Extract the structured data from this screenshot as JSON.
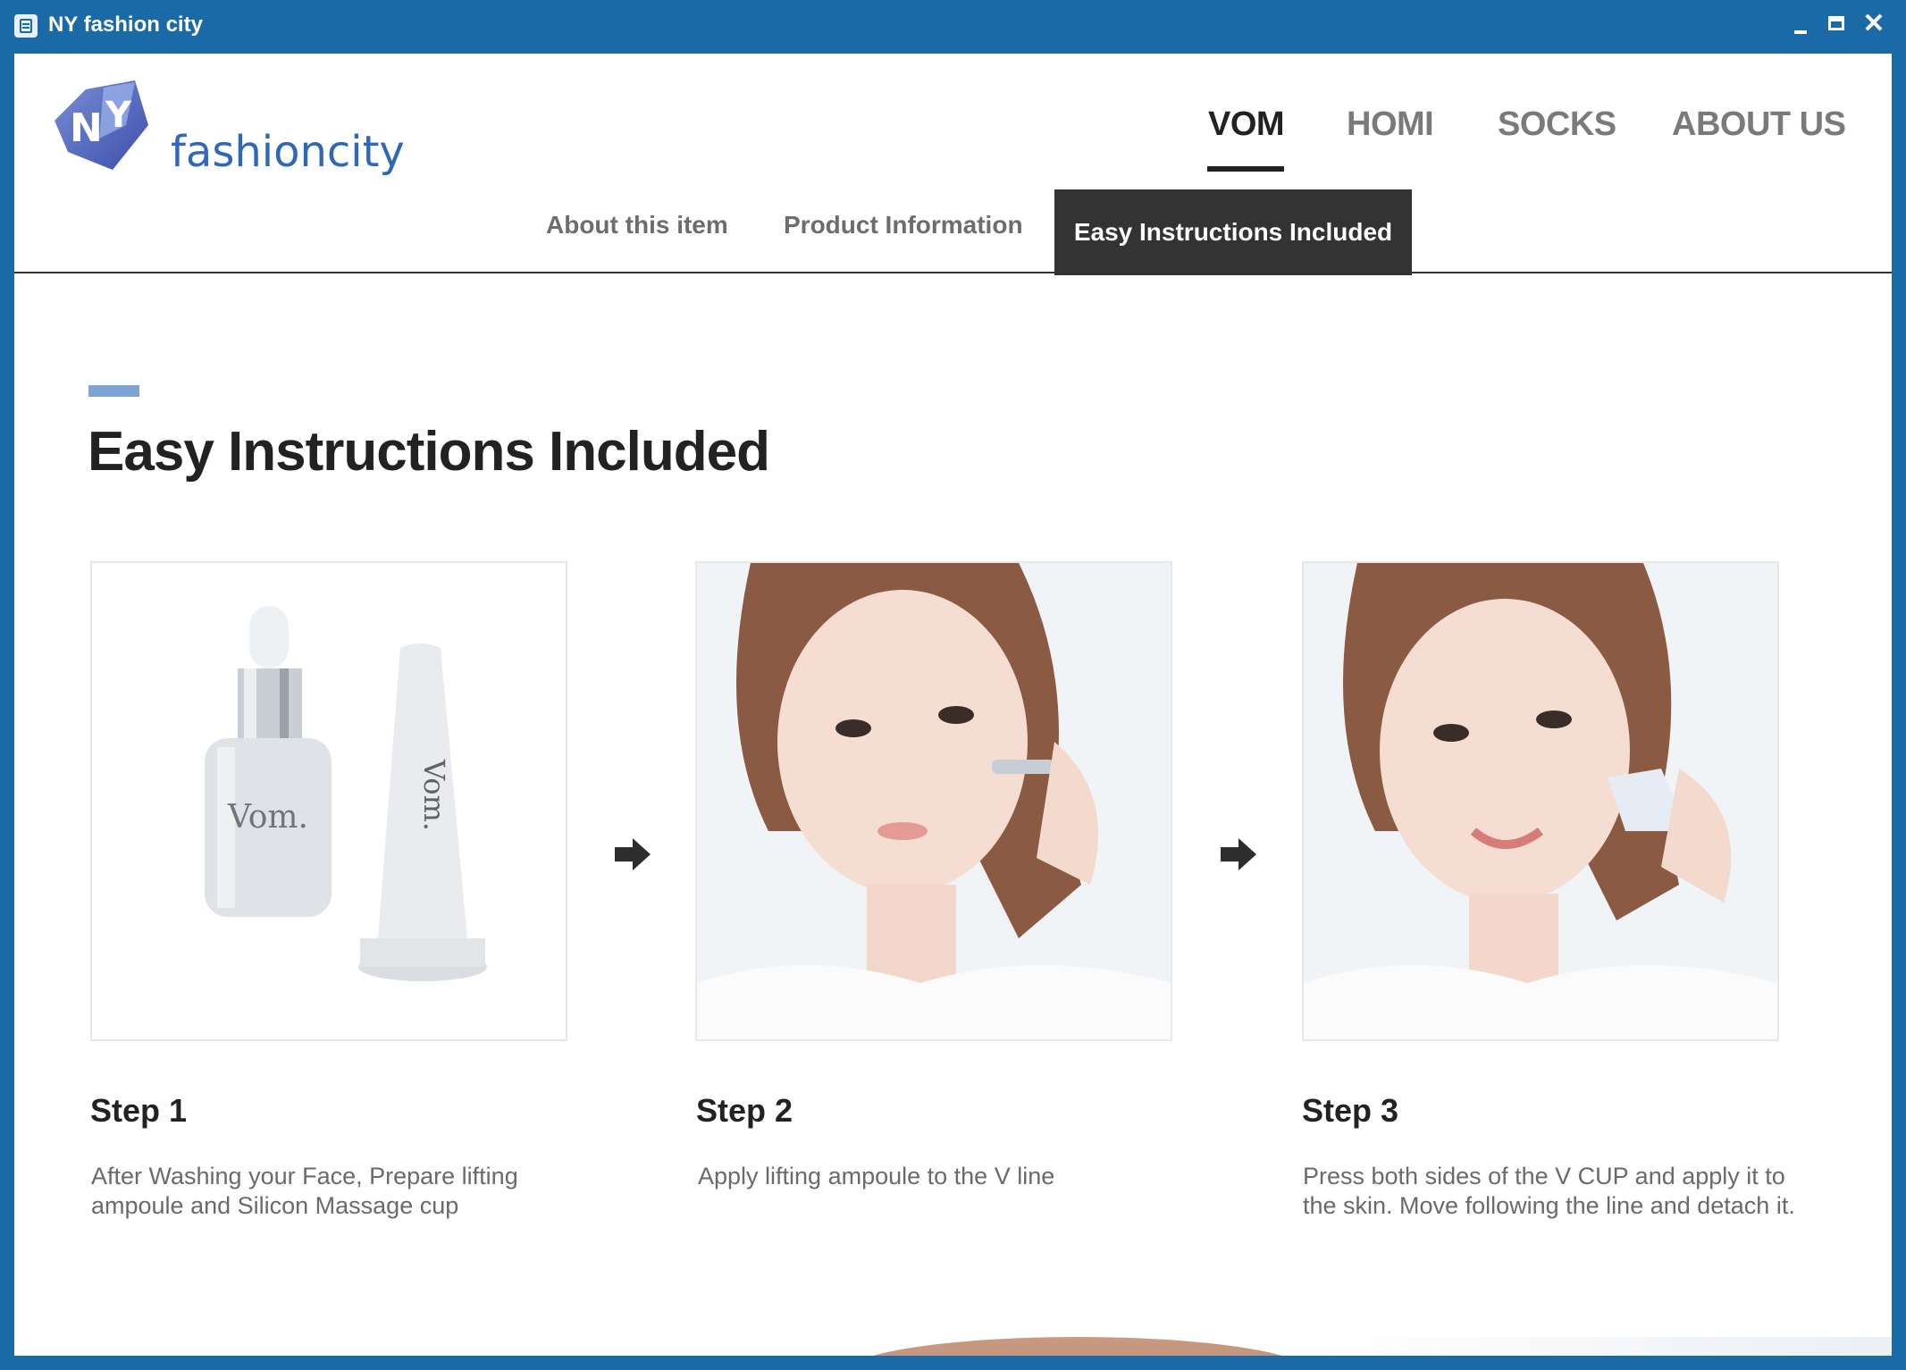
{
  "window": {
    "title": "NY fashion city"
  },
  "logo": {
    "text": "fashioncity"
  },
  "nav": {
    "items": [
      {
        "label": "VOM",
        "active": true
      },
      {
        "label": "HOMI",
        "active": false
      },
      {
        "label": "SOCKS",
        "active": false
      },
      {
        "label": "ABOUT US",
        "active": false
      }
    ]
  },
  "subnav": {
    "items": [
      {
        "label": "About this item"
      },
      {
        "label": "Product Information"
      },
      {
        "label": "Easy Instructions Included",
        "active": true
      }
    ]
  },
  "main": {
    "heading": "Easy Instructions Included",
    "steps": [
      {
        "title": "Step 1",
        "description": "After Washing your Face, Prepare lifting ampoule and Silicon Massage cup",
        "image": "product-bottle-and-cup"
      },
      {
        "title": "Step 2",
        "description": "Apply lifting ampoule to the V line",
        "image": "woman-applying-ampoule"
      },
      {
        "title": "Step 3",
        "description": "Press both sides of the V CUP and apply it to the skin. Move following the line and detach it.",
        "image": "woman-using-v-cup"
      }
    ],
    "product_brand": "Vom."
  },
  "colors": {
    "window_frame": "#1b6aa8",
    "accent": "#7ea3d6",
    "active_tab_bg": "#333333",
    "heading_text": "#222222",
    "muted_text": "#6a6a6a"
  }
}
